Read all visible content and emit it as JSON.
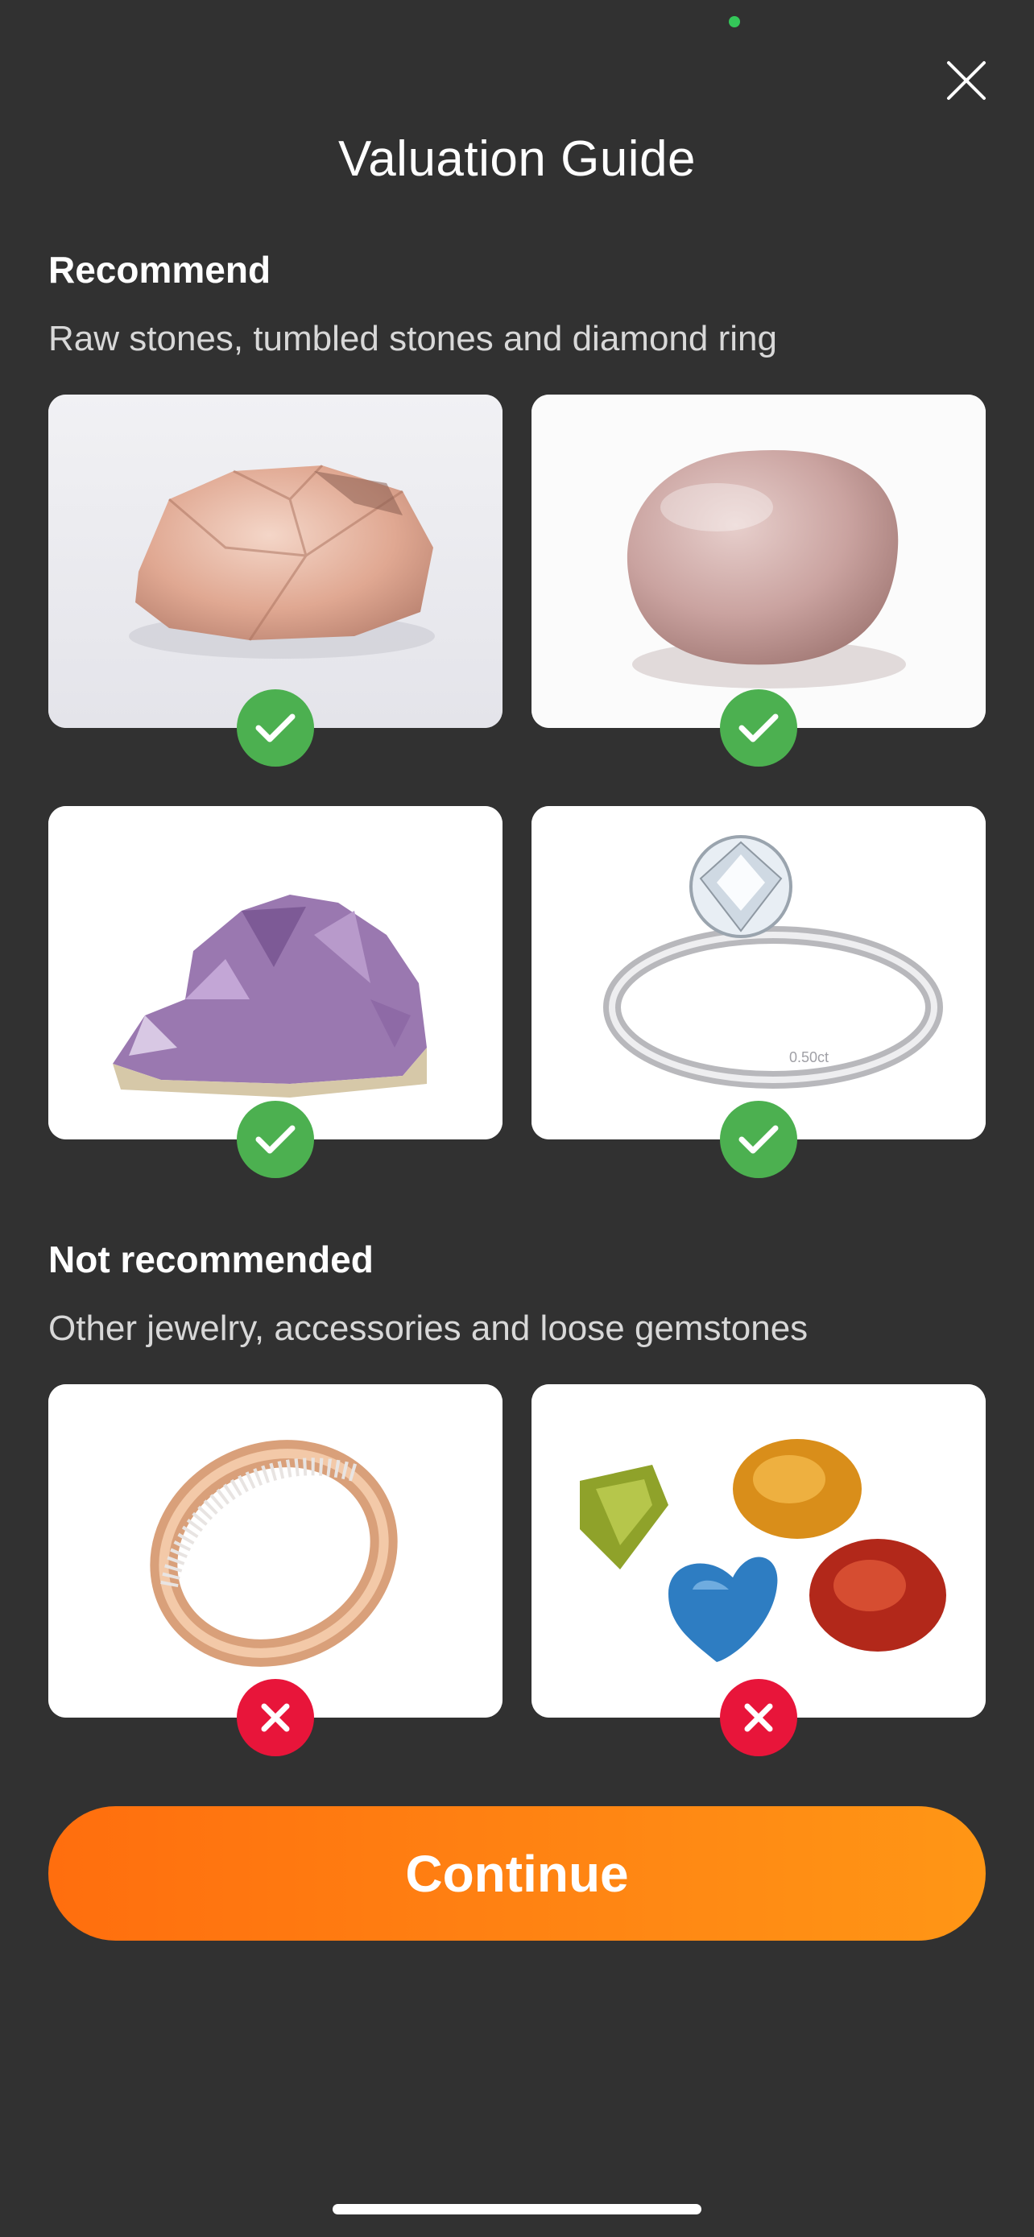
{
  "title": "Valuation Guide",
  "recommend": {
    "heading": "Recommend",
    "subtitle": "Raw stones, tumbled stones and diamond ring",
    "items": [
      {
        "name": "raw-stone",
        "icon": "check-icon"
      },
      {
        "name": "tumbled-stone",
        "icon": "check-icon"
      },
      {
        "name": "amethyst-cluster",
        "icon": "check-icon"
      },
      {
        "name": "diamond-ring",
        "icon": "check-icon"
      }
    ]
  },
  "not_recommended": {
    "heading": "Not recommended",
    "subtitle": "Other jewelry, accessories and loose gemstones",
    "items": [
      {
        "name": "gold-band-ring",
        "icon": "x-icon"
      },
      {
        "name": "loose-gemstones",
        "icon": "x-icon"
      }
    ]
  },
  "ring_engraving": "0.50ct",
  "continue_label": "Continue",
  "colors": {
    "background": "#313131",
    "accent": "#ff7a10",
    "ok": "#4cb050",
    "no": "#e8153a",
    "status_dot": "#34c759"
  }
}
